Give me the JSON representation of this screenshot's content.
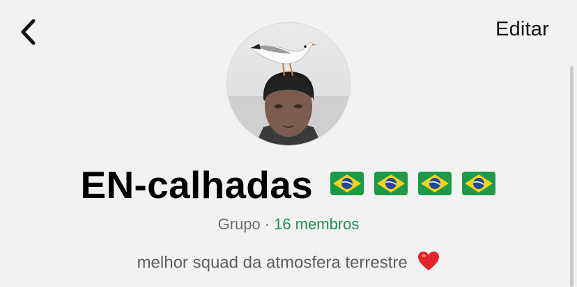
{
  "header": {
    "back_icon": "chevron-left-icon",
    "edit_label": "Editar"
  },
  "profile": {
    "avatar_description": "group-avatar-photo",
    "name": "EN-calhadas",
    "flag_icon": "brazil-flag-icon",
    "flags_count": 4,
    "type_label": "Grupo",
    "separator": "·",
    "members_label": "16 membros",
    "description": "melhor squad da atmosfera terrestre",
    "description_icon": "red-heart-icon"
  },
  "colors": {
    "background": "#f2f2f2",
    "accent": "#1f8f5a",
    "secondary_text": "#6c6c6c"
  }
}
